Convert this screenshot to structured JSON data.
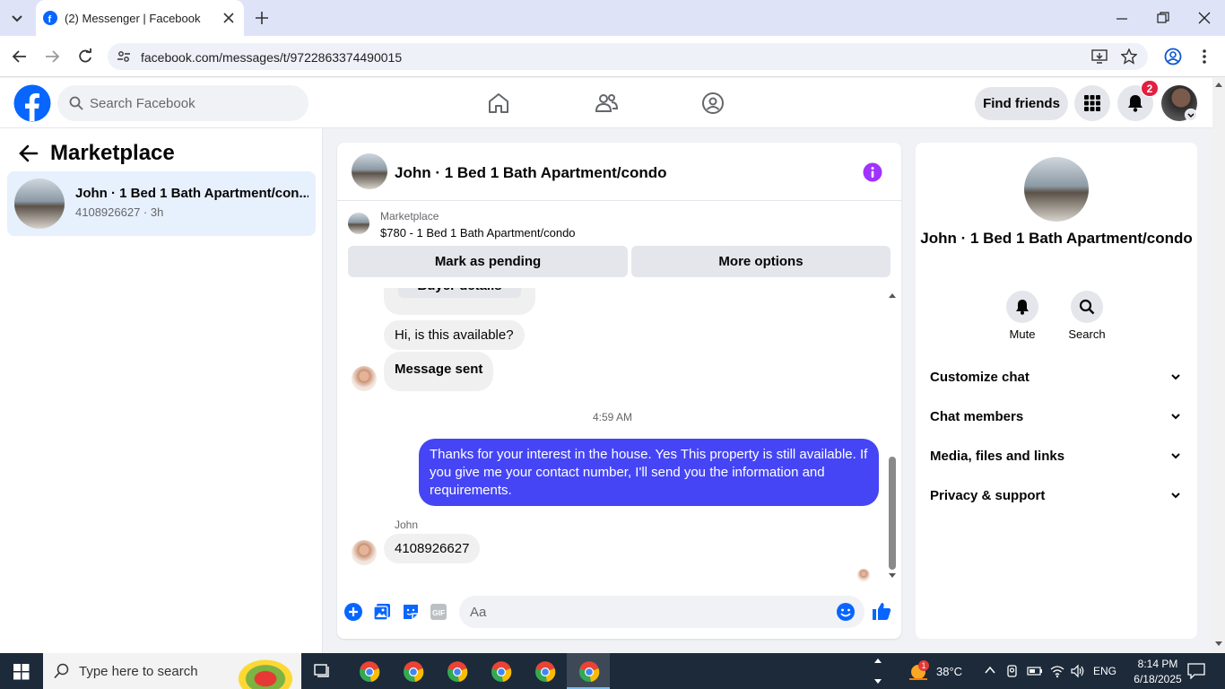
{
  "browser": {
    "tab_title": "(2) Messenger | Facebook",
    "url": "facebook.com/messages/t/9722863374490015"
  },
  "header": {
    "search_placeholder": "Search Facebook",
    "find_friends": "Find friends",
    "notification_count": "2"
  },
  "sidebar": {
    "title": "Marketplace",
    "threads": [
      {
        "name": "John · 1 Bed 1 Bath Apartment/con...",
        "meta": "4108926627 · 3h"
      }
    ]
  },
  "conversation": {
    "title": "John · 1 Bed 1 Bath Apartment/condo",
    "marketplace_label": "Marketplace",
    "listing": "$780 - 1 Bed 1 Bath Apartment/condo",
    "mark_pending": "Mark as pending",
    "more_options": "More options",
    "buyer_details": "Buyer details",
    "messages": [
      {
        "from": "them",
        "text": "Hi, is this available?"
      },
      {
        "from": "them",
        "text": "Message sent"
      },
      {
        "from": "me",
        "text": "Thanks for your interest in the house. Yes This property is still available. If you give me your contact number, I'll send you the information and requirements."
      },
      {
        "from": "them",
        "text": "4108926627"
      }
    ],
    "timestamp": "4:59 AM",
    "sender_name": "John",
    "composer_placeholder": "Aa"
  },
  "details": {
    "name": "John · 1 Bed 1 Bath Apartment/condo",
    "actions": [
      {
        "label": "Mute"
      },
      {
        "label": "Search"
      }
    ],
    "sections": [
      {
        "label": "Customize chat"
      },
      {
        "label": "Chat members"
      },
      {
        "label": "Media, files and links"
      },
      {
        "label": "Privacy & support"
      }
    ]
  },
  "taskbar": {
    "search_placeholder": "Type here to search",
    "temperature": "38°C",
    "language": "ENG",
    "time": "8:14 PM",
    "date": "6/18/2025",
    "weather_badge": "1"
  },
  "colors": {
    "facebook_blue": "#0866ff",
    "my_bubble": "#4545f5",
    "info_purple": "#a033ff",
    "notification_red": "#e41e3f"
  }
}
